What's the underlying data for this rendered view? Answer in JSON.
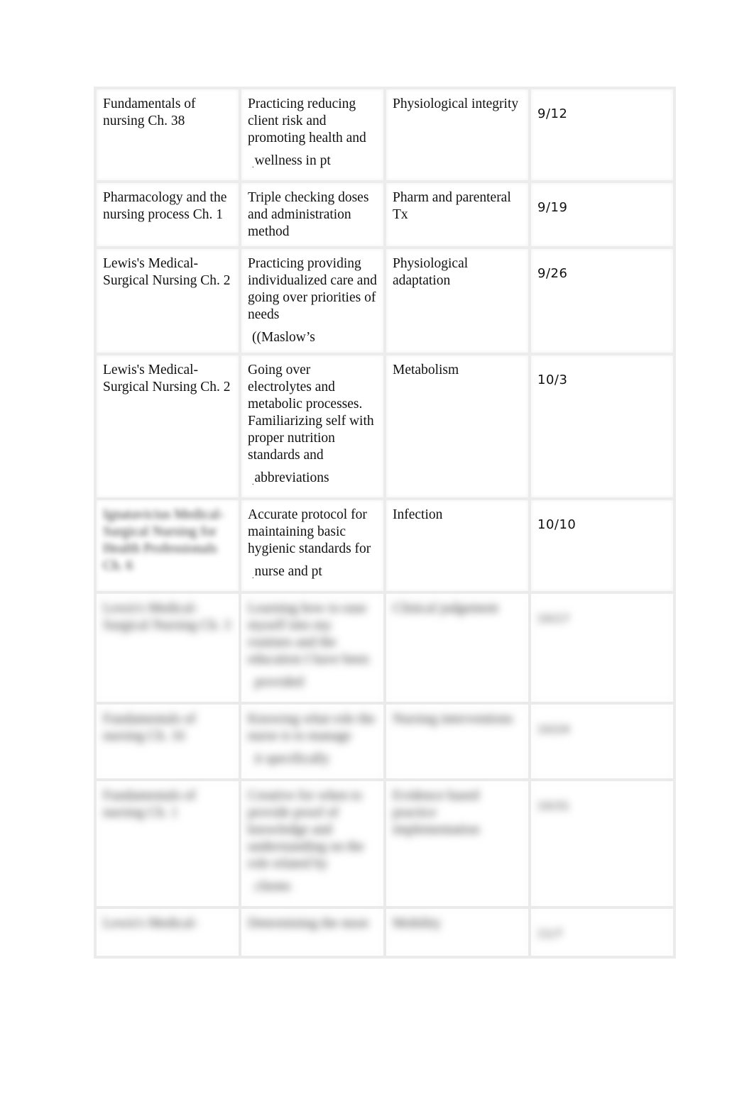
{
  "document": {
    "rows": [
      {
        "source": "Fundamentals of nursing Ch. 38",
        "activity": "Practicing reducing client risk and promoting health and",
        "activity_tail": "wellness in pt",
        "category": "Physiological integrity",
        "date": "9/12",
        "blurred": false
      },
      {
        "source": "Pharmacology and the nursing process Ch. 1",
        "activity": "Triple checking doses and administration method",
        "activity_tail": "",
        "category": "Pharm and parenteral Tx",
        "date": "9/19",
        "blurred": false
      },
      {
        "source": "Lewis's Medical-Surgical Nursing Ch. 2",
        "activity": "Practicing providing individualized care and going over priorities of needs",
        "activity_tail": "((Maslow’s",
        "category": "Physiological adaptation",
        "date": "9/26",
        "blurred": false
      },
      {
        "source": "Lewis's Medical-Surgical Nursing Ch. 2",
        "activity": "Going over electrolytes and metabolic processes. Familiarizing self with proper nutrition standards and",
        "activity_tail": "abbreviations",
        "category": "Metabolism",
        "date": "10/3",
        "blurred": false
      },
      {
        "source": "Ignatavicius Medical-Surgical Nursing for Health Professionals Ch. 6",
        "activity": "Accurate protocol for maintaining basic hygienic standards for",
        "activity_tail": "nurse and pt",
        "category": "Infection",
        "date": "10/10",
        "blurred": false,
        "source_blurred": true
      },
      {
        "source": "Lewis's Medical-Surgical Nursing Ch. 3",
        "activity": "Learning how to ease myself into my routines and the education I have been",
        "activity_tail": "provided",
        "category": "Clinical judgement",
        "date": "10/17",
        "blurred": true
      },
      {
        "source": "Fundamentals of nursing Ch. 16",
        "activity": "Knowing what role the nurse is to manage",
        "activity_tail": "it specifically",
        "category": "Nursing interventions",
        "date": "10/24",
        "blurred": true
      },
      {
        "source": "Fundamentals of nursing Ch. 1",
        "activity": "Creative for when to provide proof of knowledge and understanding on the role related by",
        "activity_tail": "clients",
        "category": "Evidence based practice implementation",
        "date": "10/31",
        "blurred": true
      },
      {
        "source": "Lewis's Medical-",
        "activity": "Determining the most",
        "activity_tail": "",
        "category": "Mobility",
        "date": "11/7",
        "blurred": true
      }
    ]
  }
}
